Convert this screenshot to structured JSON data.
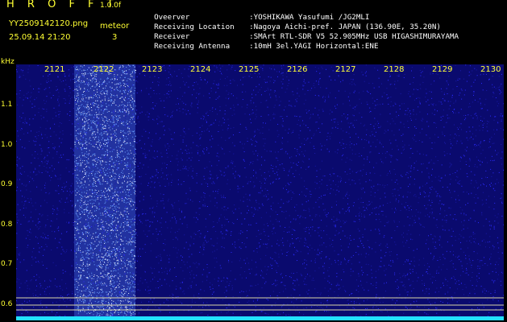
{
  "header": {
    "app_title": "H R O F F T",
    "app_version": "1.0.0f",
    "file_name": "YY2509142120.png",
    "meteor_label": "meteor",
    "datetime": "25.09.14 21:20",
    "meteor_count": "3"
  },
  "info": [
    {
      "label": "Oveerver",
      "value": ":YOSHIKAWA Yasufumi /JG2MLI"
    },
    {
      "label": "Receiving Location",
      "value": ":Nagoya Aichi-pref. JAPAN (136.90E, 35.20N)"
    },
    {
      "label": "Receiver",
      "value": ":SMArt RTL-SDR V5 52.905MHz USB HIGASHIMURAYAMA"
    },
    {
      "label": "Receiving Antenna",
      "value": ":10mH 3el.YAGI Horizontal:ENE"
    }
  ],
  "axis": {
    "y_unit": "kHz",
    "y_ticks": [
      "1.1",
      "1.0",
      "0.9",
      "0.8",
      "0.7",
      "0.6"
    ],
    "x_ticks": [
      "2121",
      "2122",
      "2123",
      "2124",
      "2125",
      "2126",
      "2127",
      "2128",
      "2129",
      "2130"
    ]
  },
  "colors": {
    "label": "#ffff33",
    "noise_background": "#0a0a6e",
    "echo": "#4f7dff",
    "baseline": "#22e0ff",
    "reference_lines": "#fffbb0"
  }
}
